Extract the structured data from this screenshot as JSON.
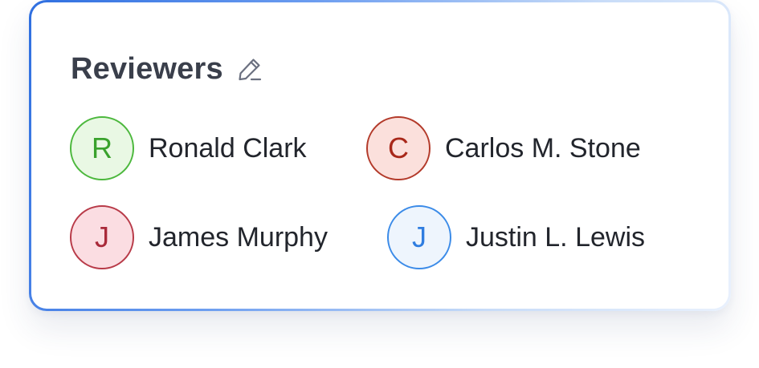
{
  "panel": {
    "title": "Reviewers",
    "edit_icon": "pencil-edit-icon"
  },
  "reviewers": [
    {
      "initial": "R",
      "name": "Ronald Clark",
      "colors": {
        "border": "#4cb83d",
        "background": "#e9f8e4",
        "text": "#3aa22d"
      }
    },
    {
      "initial": "C",
      "name": "Carlos M. Stone",
      "colors": {
        "border": "#b33a2a",
        "background": "#fbe0dc",
        "text": "#a8281a"
      }
    },
    {
      "initial": "J",
      "name": "James Murphy",
      "colors": {
        "border": "#b83a48",
        "background": "#fbdde2",
        "text": "#a92a3a"
      }
    },
    {
      "initial": "J",
      "name": "Justin L. Lewis",
      "colors": {
        "border": "#3b8be8",
        "background": "#eef5fd",
        "text": "#2f7de0"
      }
    }
  ]
}
